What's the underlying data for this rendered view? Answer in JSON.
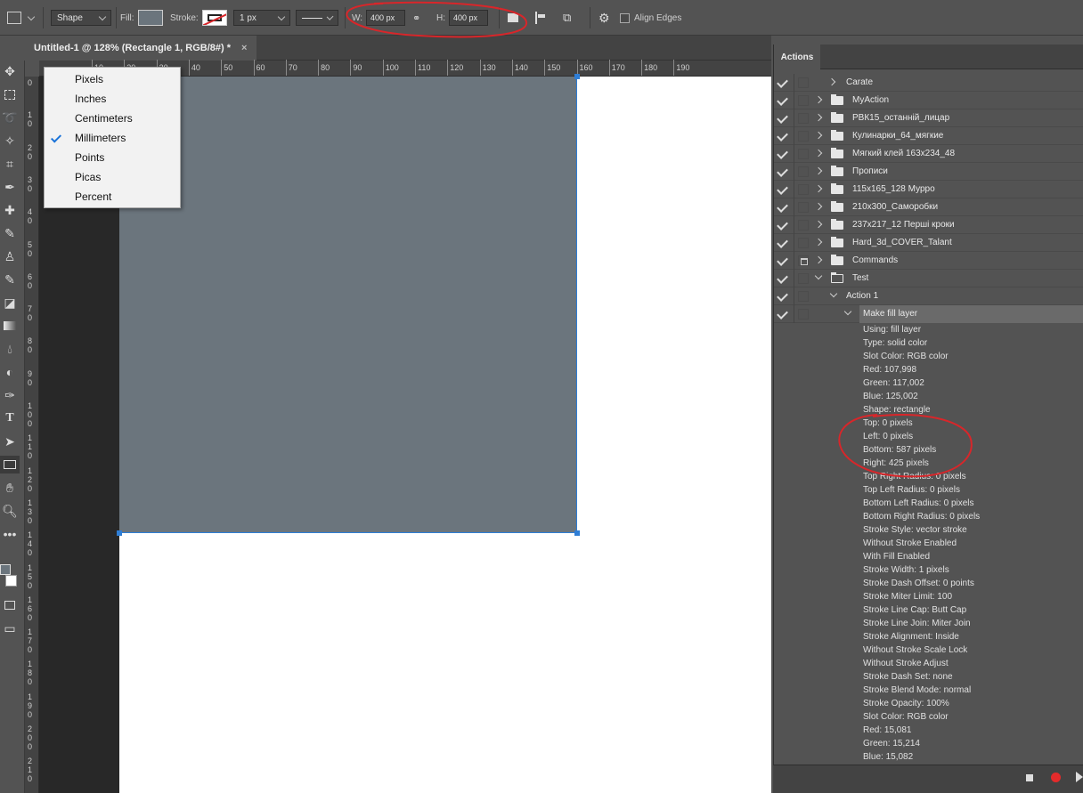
{
  "options_bar": {
    "mode": "Shape",
    "fill_label": "Fill:",
    "stroke_label": "Stroke:",
    "stroke_width": "1 px",
    "w_label": "W:",
    "w_value": "400 px",
    "h_label": "H:",
    "h_value": "400 px",
    "align_edges": "Align Edges",
    "fill_color": "#6b757d"
  },
  "document_tab": {
    "title": "Untitled-1 @ 128% (Rectangle 1, RGB/8#) *",
    "close": "×"
  },
  "ruler": {
    "horizontal_ticks": [
      "10",
      "20",
      "30",
      "40",
      "50",
      "60",
      "70",
      "80",
      "90",
      "100",
      "110",
      "120",
      "130",
      "140",
      "150",
      "160",
      "170",
      "180",
      "190"
    ],
    "vertical_ticks": [
      "0",
      "10",
      "20",
      "30",
      "40",
      "50",
      "60",
      "70",
      "80",
      "90",
      "100",
      "110",
      "120",
      "130",
      "140",
      "150",
      "160",
      "170",
      "180",
      "190",
      "200",
      "210"
    ]
  },
  "units_menu": {
    "items": [
      "Pixels",
      "Inches",
      "Centimeters",
      "Millimeters",
      "Points",
      "Picas",
      "Percent"
    ],
    "selected": "Millimeters"
  },
  "actions_panel": {
    "tab": "Actions",
    "sets": [
      {
        "name": "Carate"
      },
      {
        "name": "MyAction"
      },
      {
        "name": "РВК15_останній_лицар"
      },
      {
        "name": "Кулинарки_64_мягкие"
      },
      {
        "name": "Мягкий клей 163х234_48"
      },
      {
        "name": "Прописи"
      },
      {
        "name": "115х165_128 Мурро"
      },
      {
        "name": "210х300_Саморобки"
      },
      {
        "name": "237х217_12 Перші кроки"
      },
      {
        "name": "Hard_3d_COVER_Talant"
      },
      {
        "name": "Commands"
      },
      {
        "name": "Test"
      }
    ],
    "action": "Action 1",
    "step": "Make fill layer",
    "details": [
      "Using: fill layer",
      "Type: solid color",
      "Slot Color: RGB color",
      "Red: 107,998",
      "Green: 117,002",
      "Blue: 125,002",
      "Shape: rectangle",
      "Top: 0 pixels",
      "Left: 0 pixels",
      "Bottom: 587 pixels",
      "Right: 425 pixels",
      "Top Right Radius: 0 pixels",
      "Top Left Radius: 0 pixels",
      "Bottom Left Radius: 0 pixels",
      "Bottom Right Radius: 0 pixels",
      "Stroke Style: vector stroke",
      "Without Stroke Enabled",
      "With Fill Enabled",
      "Stroke Width: 1 pixels",
      "Stroke Dash Offset: 0 points",
      "Stroke Miter Limit: 100",
      "Stroke Line Cap: Butt Cap",
      "Stroke Line Join: Miter Join",
      "Stroke Alignment: Inside",
      "Without Stroke Scale Lock",
      "Without Stroke Adjust",
      "Stroke Dash Set: none",
      "Stroke Blend Mode: normal",
      "Stroke Opacity: 100%",
      "Slot Color: RGB color",
      "Red: 15,081",
      "Green: 15,214",
      "Blue: 15,082"
    ]
  },
  "colors": {
    "rectangle": "#6b757d",
    "selection": "#2e7ed6",
    "annotation": "#d8262a",
    "record": "#e32b2b"
  }
}
